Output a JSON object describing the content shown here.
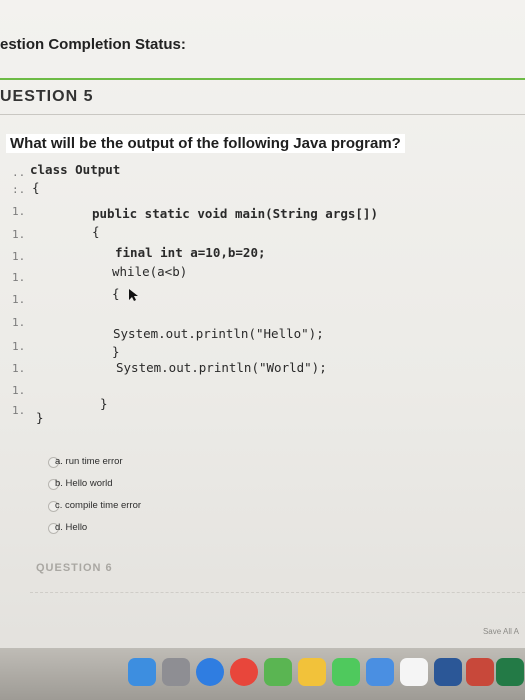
{
  "status": {
    "title": "estion Completion Status:"
  },
  "question_header": "UESTION 5",
  "question": {
    "prompt": "What will be the output of the following Java program?",
    "code_lines": [
      "class Output",
      "{",
      "public static void main(String args[])",
      "{",
      "final int a=10,b=20;",
      "while(a<b)",
      "{",
      "System.out.println(\"Hello\");",
      "}",
      "System.out.println(\"World\");",
      "}",
      "}"
    ]
  },
  "answers": [
    "a. run time error",
    "b. Hello world",
    "c. compile time error",
    "d. Hello"
  ],
  "next_question": "QUESTION 6",
  "footer": {
    "save_all": "Save All A"
  },
  "dock_icons": [
    "finder-icon",
    "launchpad-icon",
    "safari-icon",
    "chrome-icon",
    "maps-icon",
    "photos-icon",
    "messages-icon",
    "mail-icon",
    "calendar-icon",
    "notes-icon",
    "word-icon",
    "powerpoint-icon",
    "excel-icon"
  ]
}
